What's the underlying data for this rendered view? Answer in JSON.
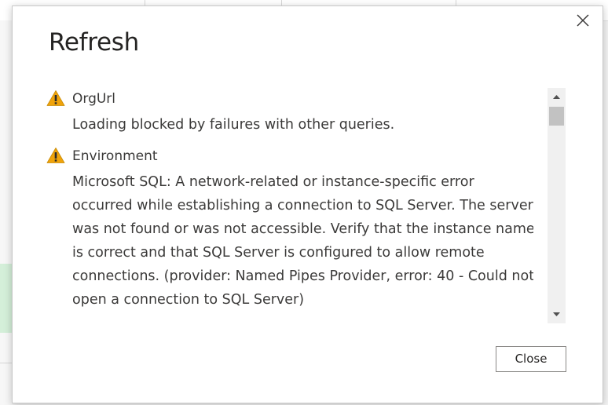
{
  "dialog": {
    "title": "Refresh",
    "close_icon": "close-icon",
    "messages": [
      {
        "icon": "warning-icon",
        "title": "OrgUrl",
        "body": "Loading blocked by failures with other queries."
      },
      {
        "icon": "warning-icon",
        "title": "Environment",
        "body": "Microsoft SQL: A network-related or instance-specific error occurred while establishing a connection to SQL Server. The server was not found or was not accessible. Verify that the instance name is correct and that SQL Server is configured to allow remote connections. (provider: Named Pipes Provider, error: 40 - Could not open a connection to SQL Server)"
      }
    ],
    "close_button_label": "Close"
  },
  "colors": {
    "warning_fill": "#f0a30a",
    "text": "#3b3a39",
    "title": "#252423",
    "scroll_thumb": "#c2c2c2",
    "background_green": "#d4efd9"
  }
}
